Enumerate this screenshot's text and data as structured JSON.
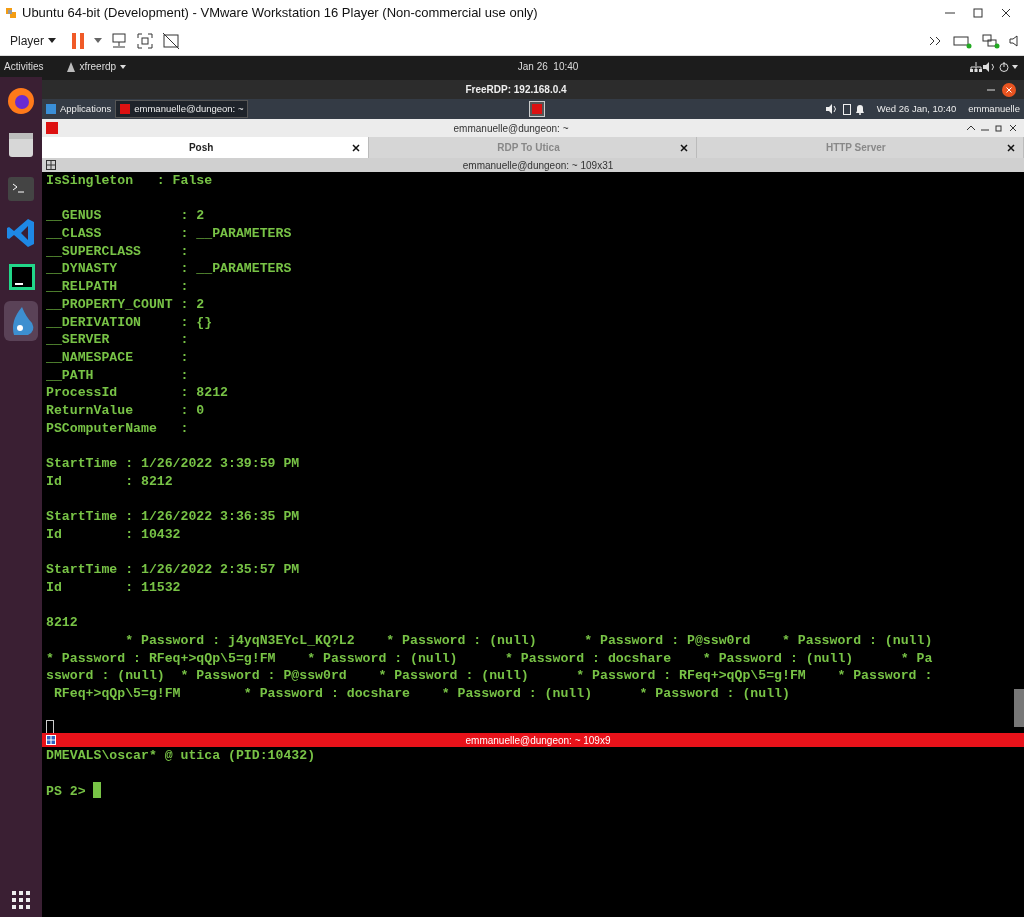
{
  "window": {
    "title": "Ubuntu 64-bit (Development) - VMware Workstation 16 Player (Non-commercial use only)"
  },
  "toolbar": {
    "player_menu": "Player"
  },
  "ubuntu_bar": {
    "activities": "Activities",
    "app_menu": "xfreerdp",
    "clock": "Jan 26  10:40"
  },
  "dock": {
    "items": [
      {
        "kind": "browser",
        "selected": false
      },
      {
        "kind": "files",
        "selected": false
      },
      {
        "kind": "terminal",
        "selected": false
      },
      {
        "kind": "editor",
        "selected": false
      },
      {
        "kind": "ide",
        "selected": false
      },
      {
        "kind": "mascot",
        "selected": true
      }
    ]
  },
  "rdp_window": {
    "title": "FreeRDP: 192.168.0.4"
  },
  "xfce_panel": {
    "applications": "Applications",
    "tasks": [
      {
        "label": "emmanuelle@dungeon: ~"
      }
    ],
    "clock": "Wed 26 Jan, 10:40",
    "user": "emmanuelle"
  },
  "terminator": {
    "title": "emmanuelle@dungeon: ~",
    "tabs": [
      {
        "label": "Posh",
        "selected": true
      },
      {
        "label": "RDP To Utica",
        "selected": false
      },
      {
        "label": "HTTP Server",
        "selected": false
      }
    ],
    "panes": [
      {
        "title": "emmanuelle@dungeon: ~ 109x31",
        "focused": false,
        "blocks": [
          [
            "IsSingleton   : False"
          ],
          [
            "__GENUS          : 2",
            "__CLASS          : __PARAMETERS",
            "__SUPERCLASS     :",
            "__DYNASTY        : __PARAMETERS",
            "__RELPATH        :",
            "__PROPERTY_COUNT : 2",
            "__DERIVATION     : {}",
            "__SERVER         :",
            "__NAMESPACE      :",
            "__PATH           :",
            "ProcessId        : 8212",
            "ReturnValue      : 0",
            "PSComputerName   :"
          ],
          [
            "StartTime : 1/26/2022 3:39:59 PM",
            "Id        : 8212"
          ],
          [
            "StartTime : 1/26/2022 3:36:35 PM",
            "Id        : 10432"
          ],
          [
            "StartTime : 1/26/2022 2:35:57 PM",
            "Id        : 11532"
          ],
          [
            "8212",
            "          * Password : j4yqN3EYcL_KQ?L2    * Password : (null)      * Password : P@ssw0rd    * Password : (null)",
            "* Password : RFeq+>qQp\\5=g!FM    * Password : (null)      * Password : docshare    * Password : (null)      * Pa",
            "ssword : (null)  * Password : P@ssw0rd    * Password : (null)      * Password : RFeq+>qQp\\5=g!FM    * Password :",
            " RFeq+>qQp\\5=g!FM        * Password : docshare    * Password : (null)      * Password : (null)"
          ]
        ]
      },
      {
        "title": "emmanuelle@dungeon: ~ 109x9",
        "focused": true,
        "blocks": [
          [
            "DMEVALS\\oscar* @ utica (PID:10432)"
          ]
        ],
        "prompt": "PS 2> "
      }
    ]
  }
}
